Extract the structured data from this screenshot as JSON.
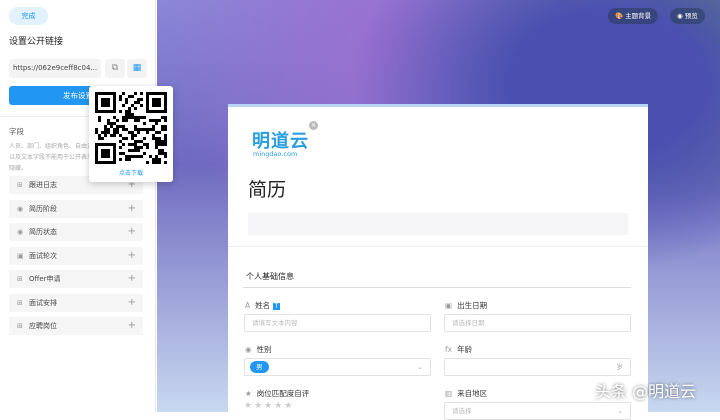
{
  "sidebar": {
    "done_label": "完成",
    "title": "设置公开链接",
    "url": "https://062e9ceff8c04...",
    "publish_label": "发布设置",
    "fields_label": "字段",
    "fields_desc": "人员、部门、组织角色、自由连接、签名、条码等，以及文本字段不能用于公开表单，相关字段将被自动隐藏。",
    "items": [
      {
        "icon": "link-icon",
        "glyph": "⊞",
        "label": "跟进日志"
      },
      {
        "icon": "option-icon",
        "glyph": "◉",
        "label": "简历阶段"
      },
      {
        "icon": "option-icon",
        "glyph": "◉",
        "label": "简历状态"
      },
      {
        "icon": "dropdown-icon",
        "glyph": "▣",
        "label": "面试轮次"
      },
      {
        "icon": "link-icon",
        "glyph": "⊞",
        "label": "Offer申请"
      },
      {
        "icon": "link-icon",
        "glyph": "⊞",
        "label": "面试安排"
      },
      {
        "icon": "link-icon",
        "glyph": "⊞",
        "label": "应聘岗位"
      }
    ]
  },
  "qr_popup": {
    "download_label": "点击下载"
  },
  "top_buttons": {
    "theme": "主题背景",
    "preview": "预览"
  },
  "form": {
    "logo_text": "明道云",
    "logo_sub": "mingdao.com",
    "title": "简历",
    "section": "个人基础信息",
    "fields": {
      "name_label": "姓名",
      "name_placeholder": "请填写文本内容",
      "birth_label": "出生日期",
      "birth_placeholder": "请选择日期",
      "gender_label": "性别",
      "gender_value": "男",
      "age_label": "年龄",
      "age_unit": "岁",
      "match_label": "岗位匹配度自评",
      "region_label": "来自地区",
      "region_placeholder": "请选择"
    }
  },
  "watermark": "头条 @明道云"
}
